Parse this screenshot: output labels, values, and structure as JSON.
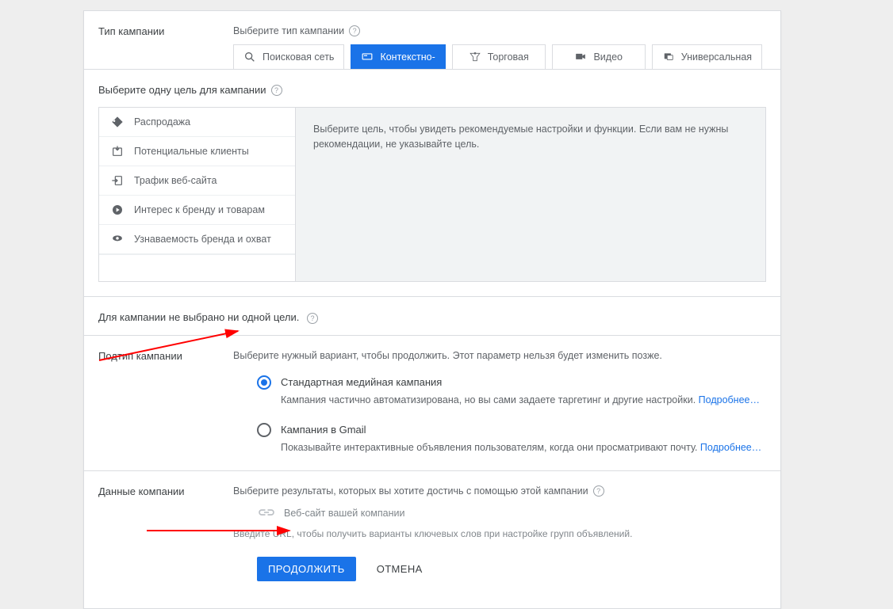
{
  "campaign_type": {
    "label": "Тип кампании",
    "prompt": "Выберите тип кампании",
    "tabs": [
      {
        "label": "Поисковая сеть"
      },
      {
        "label": "Контекстно-"
      },
      {
        "label": "Торговая"
      },
      {
        "label": "Видео"
      },
      {
        "label": "Универсальная"
      }
    ]
  },
  "goals": {
    "prompt": "Выберите одну цель для кампании",
    "items": [
      {
        "label": "Распродажа",
        "icon": "tag"
      },
      {
        "label": "Потенциальные клиенты",
        "icon": "lead"
      },
      {
        "label": "Трафик веб-сайта",
        "icon": "arrow-in"
      },
      {
        "label": "Интерес к бренду и товарам",
        "icon": "play"
      },
      {
        "label": "Узнаваемость бренда и охват",
        "icon": "eye"
      }
    ],
    "help_text": "Выберите цель, чтобы увидеть рекомендуемые настройки и функции. Если вам не нужны рекомендации, не указывайте цель.",
    "no_goals": "Для кампании не выбрано ни одной цели."
  },
  "subtype": {
    "label": "Подтип кампании",
    "prompt": "Выберите нужный вариант, чтобы продолжить. Этот параметр нельзя будет изменить позже.",
    "options": [
      {
        "label": "Стандартная медийная кампания",
        "desc": "Кампания частично автоматизирована, но вы сами задаете таргетинг и другие настройки.",
        "more": "Подробнее…",
        "checked": true
      },
      {
        "label": "Кампания в Gmail",
        "desc": "Показывайте интерактивные объявления пользователям, когда они просматривают почту.",
        "more": "Подробнее…",
        "checked": false
      }
    ]
  },
  "company": {
    "label": "Данные компании",
    "prompt": "Выберите результаты, которых вы хотите достичь с помощью этой кампании",
    "website_label": "Веб-сайт вашей компании",
    "url_hint": "Введите URL, чтобы получить варианты ключевых слов при настройке групп объявлений."
  },
  "buttons": {
    "continue": "ПРОДОЛЖИТЬ",
    "cancel": "ОТМЕНА"
  }
}
